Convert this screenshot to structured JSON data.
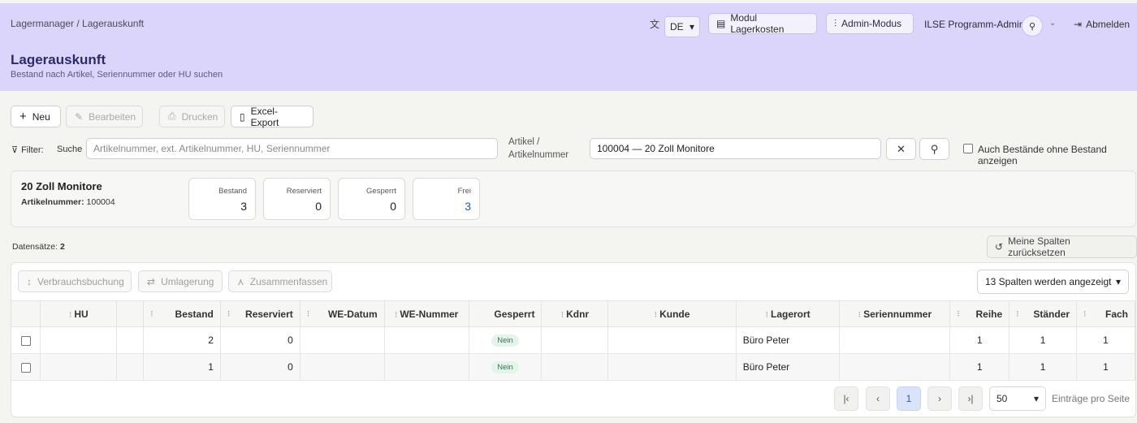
{
  "header": {
    "breadcrumb": "Lagermanager / Lagerauskunft",
    "title": "Lagerauskunft",
    "subtitle": "Bestand nach Artikel, Seriennummer oder HU suchen",
    "language": "DE",
    "modul_button": "Modul Lagerkosten",
    "admin_button": "Admin-Modus",
    "user_name": "ILSE Programm-Admin",
    "logout": "Abmelden"
  },
  "toolbar": {
    "new": "Neu",
    "edit": "Bearbeiten",
    "print": "Drucken",
    "excel": "Excel-Export"
  },
  "filter": {
    "label": "Filter:",
    "search_label": "Suche",
    "search_placeholder": "Artikelnummer, ext. Artikelnummer, HU, Seriennummer",
    "article_label": "Artikel / Artikelnummer",
    "article_value": "100004 — 20 Zoll Monitore",
    "include_empty_label": "Auch Bestände ohne Bestand anzeigen"
  },
  "article": {
    "name": "20 Zoll Monitore",
    "number_label": "Artikelnummer:",
    "number": "100004",
    "stats": [
      {
        "label": "Bestand",
        "value": "3"
      },
      {
        "label": "Reserviert",
        "value": "0"
      },
      {
        "label": "Gesperrt",
        "value": "0"
      },
      {
        "label": "Frei",
        "value": "3"
      }
    ]
  },
  "records": {
    "label": "Datensätze:",
    "count": "2"
  },
  "reset_columns": "Meine Spalten zurücksetzen",
  "actions": {
    "consumption": "Verbrauchsbuchung",
    "transfer": "Umlagerung",
    "merge": "Zusammenfassen",
    "columns_shown": "13 Spalten werden angezeigt"
  },
  "table": {
    "columns": [
      "HU",
      "Bestand",
      "Reserviert",
      "WE-Datum",
      "WE-Nummer",
      "Gesperrt",
      "Kdnr",
      "Kunde",
      "Lagerort",
      "Seriennummer",
      "Reihe",
      "Ständer",
      "Fach"
    ],
    "rows": [
      {
        "hu": "",
        "bestand": "2",
        "reserviert": "0",
        "we_datum": "",
        "we_nummer": "",
        "gesperrt": "Nein",
        "kdnr": "",
        "kunde": "",
        "lagerort": "Büro Peter",
        "seriennummer": "",
        "reihe": "1",
        "staender": "1",
        "fach": "1"
      },
      {
        "hu": "",
        "bestand": "1",
        "reserviert": "0",
        "we_datum": "",
        "we_nummer": "",
        "gesperrt": "Nein",
        "kdnr": "",
        "kunde": "",
        "lagerort": "Büro Peter",
        "seriennummer": "",
        "reihe": "1",
        "staender": "1",
        "fach": "1"
      }
    ]
  },
  "pagination": {
    "current_page": "1",
    "per_page": "50",
    "per_page_label": "Einträge pro Seite"
  }
}
